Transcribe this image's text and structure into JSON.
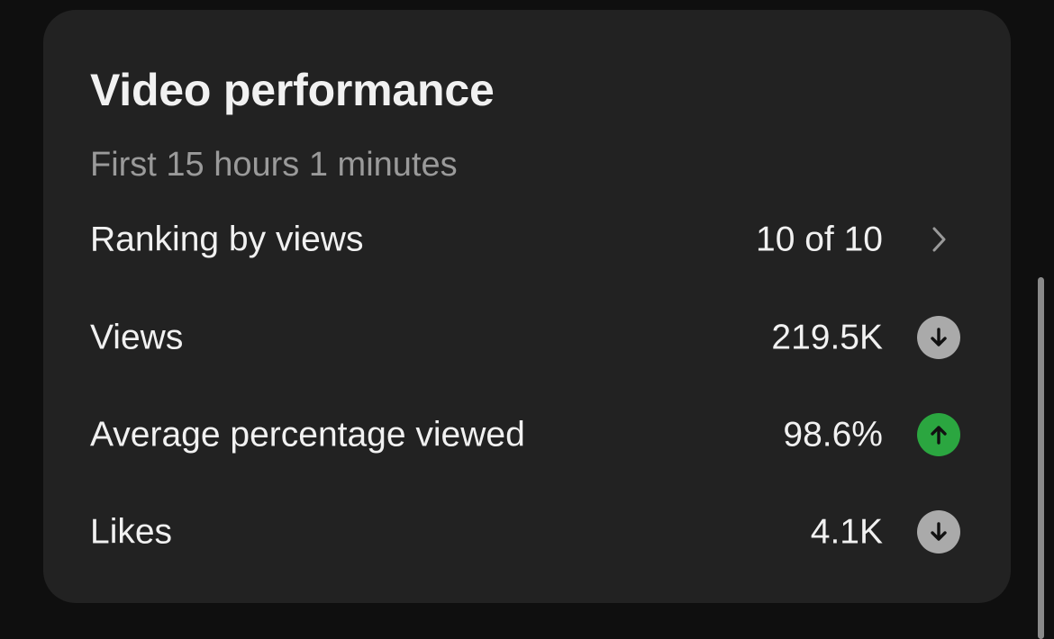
{
  "card": {
    "title": "Video performance",
    "subtitle": "First 15 hours 1 minutes"
  },
  "rows": [
    {
      "label": "Ranking by views",
      "value": "10 of 10",
      "indicator": "chevron-right-icon"
    },
    {
      "label": "Views",
      "value": "219.5K",
      "indicator": "arrow-down-icon",
      "trend": "down",
      "trend_color": "#aaaaaa"
    },
    {
      "label": "Average percentage viewed",
      "value": "98.6%",
      "indicator": "arrow-up-icon",
      "trend": "up",
      "trend_color": "#2ba640"
    },
    {
      "label": "Likes",
      "value": "4.1K",
      "indicator": "arrow-down-icon",
      "trend": "down",
      "trend_color": "#aaaaaa"
    }
  ]
}
